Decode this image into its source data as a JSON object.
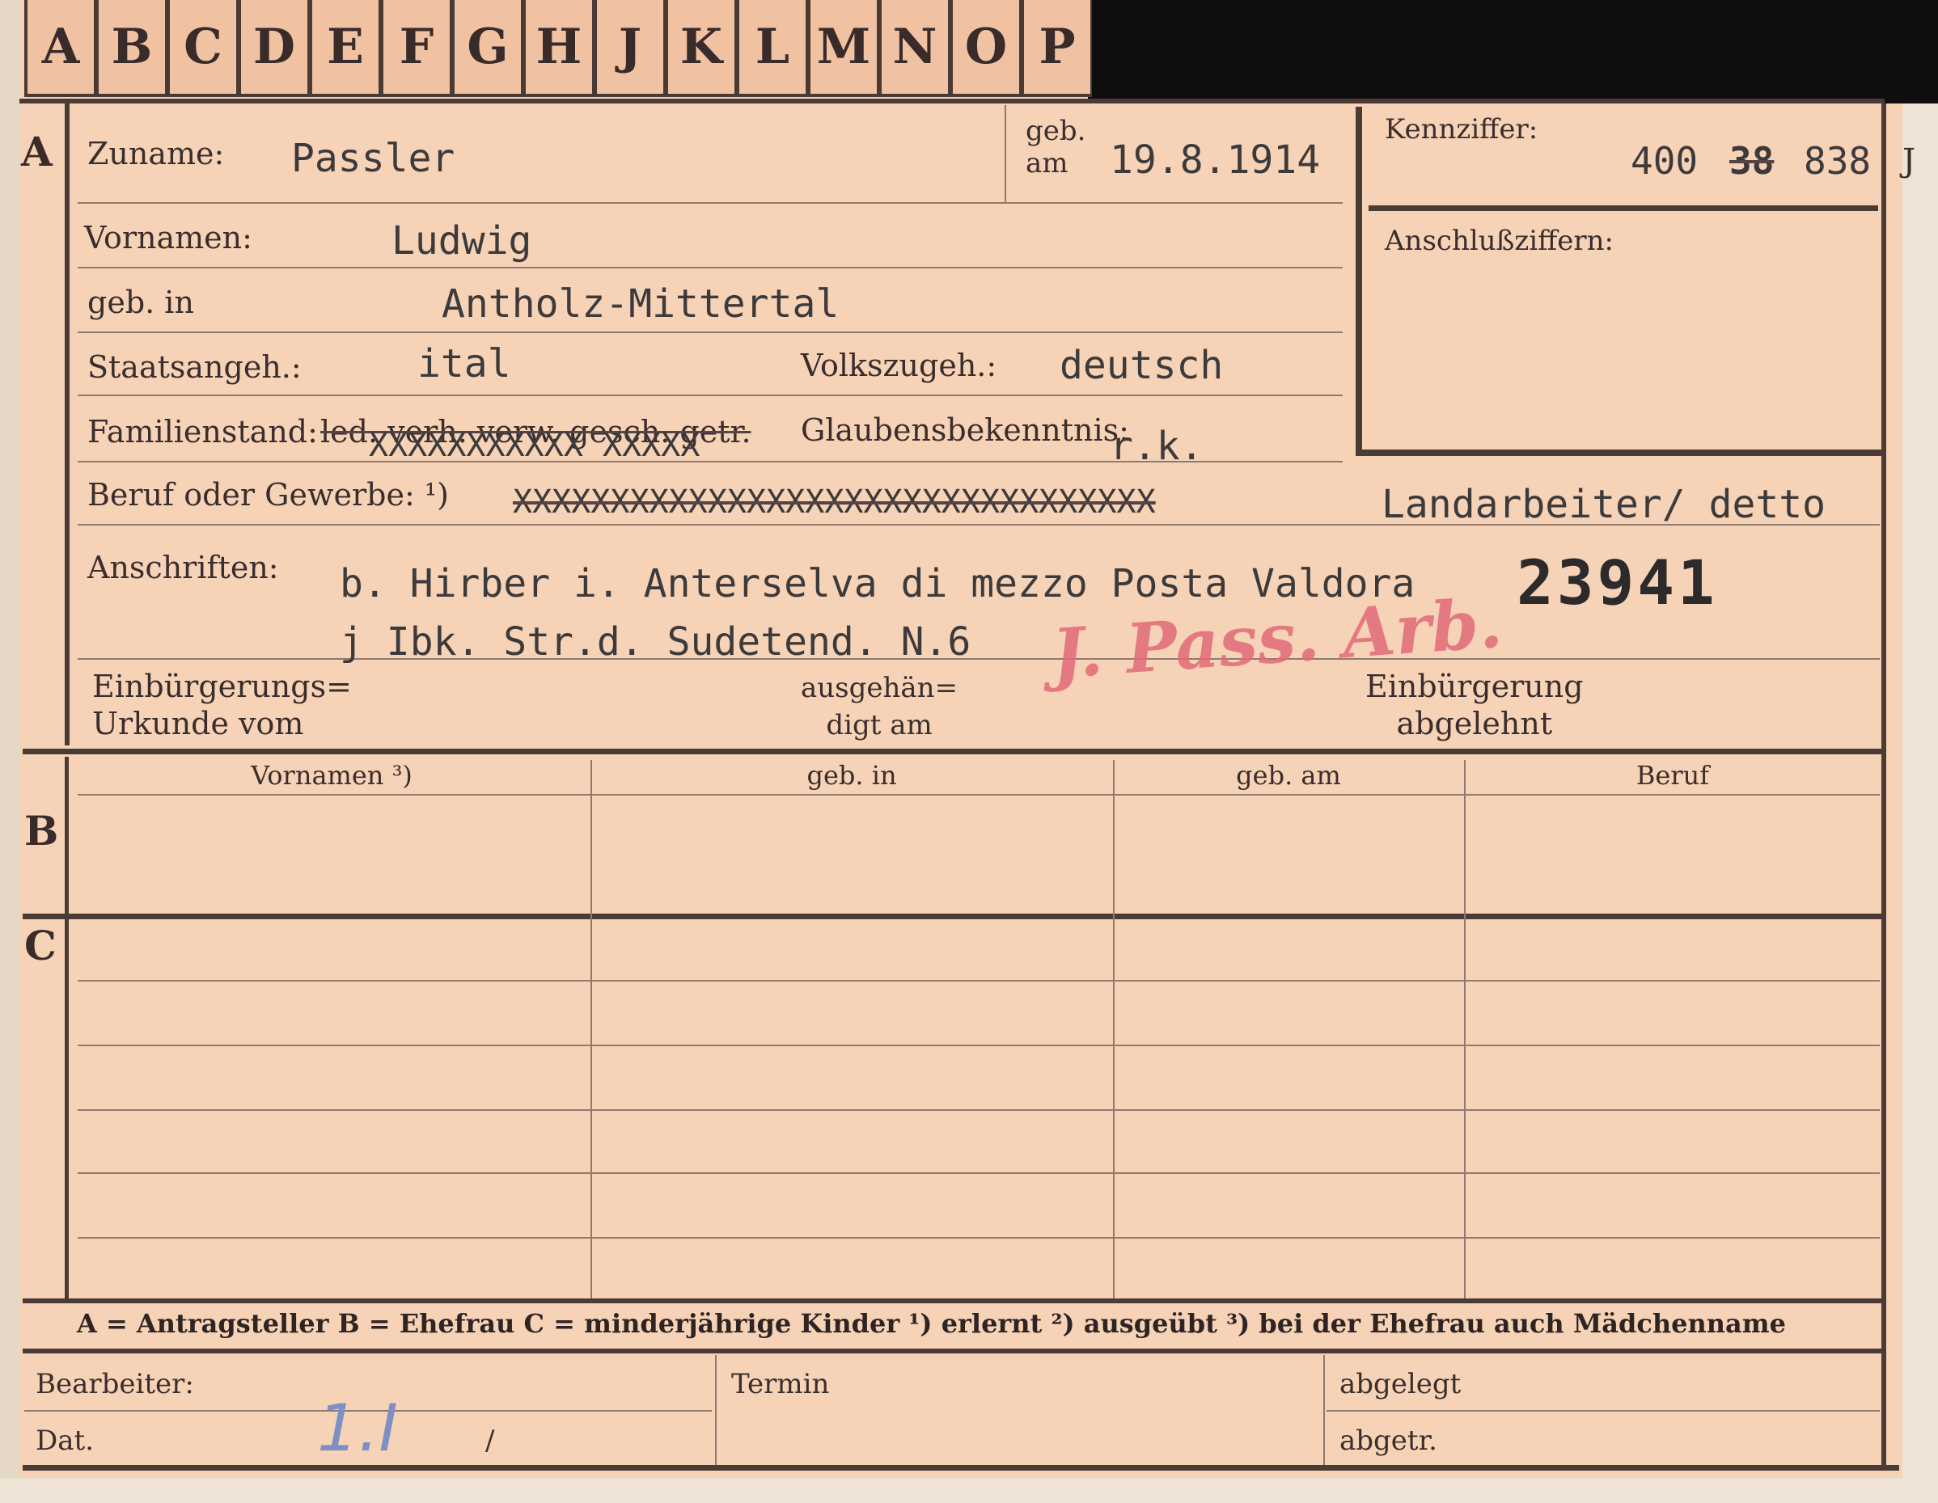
{
  "tabs": [
    "A",
    "B",
    "C",
    "D",
    "E",
    "F",
    "G",
    "H",
    "J",
    "K",
    "L",
    "M",
    "N",
    "O",
    "P"
  ],
  "sections": {
    "a": "A",
    "b": "B",
    "c": "C"
  },
  "labels": {
    "zuname": "Zuname:",
    "geb_am": "geb.\nam",
    "kennziffer": "Kennziffer:",
    "anschlussziffern": "Anschlußziffern:",
    "vornamen": "Vornamen:",
    "geb_in": "geb. in",
    "staatsangeh": "Staatsangeh.:",
    "volkszugeh": "Volkszugeh.:",
    "familienstand": "Familienstand:",
    "familienstand_opts": "led. verh. verw. gesch. getr.",
    "glaubensbekenntnis": "Glaubensbekenntnis:",
    "beruf": "Beruf oder Gewerbe: ¹)",
    "anschriften": "Anschriften:",
    "einbuergerungs_urkunde": "Einbürgerungs=\nUrkunde vom",
    "ausgehaendigt": "ausgehän=\ndigt am",
    "einbuergerung_abgelehnt": "Einbürgerung\nabgelehnt"
  },
  "values": {
    "zuname": "Passler",
    "geb_am": "19.8.1914",
    "kennziffer_a": "400",
    "kennziffer_b": "38",
    "kennziffer_c": "838",
    "kennziffer_side": "J",
    "vornamen": "Ludwig",
    "geb_in": "Antholz-Mittertal",
    "staatsangeh": "ital",
    "volkszugeh": "deutsch",
    "familienstand_x": "XXXXXXXXXXX XXXXX",
    "glaubensbekenntnis": "r.k.",
    "beruf_struck": "XXXXXXXXXXXXXXXXXXXXXXXXXXXXXXXXX",
    "beruf": "Landarbeiter/ detto",
    "anschrift_1": "b. Hirber i. Anterselva di mezzo Posta Valdora",
    "anschrift_2": "j Ibk. Str.d. Sudetend. N.6",
    "stamp_number": "23941"
  },
  "table_headers": [
    "Vornamen ³)",
    "geb. in",
    "geb. am",
    "Beruf"
  ],
  "legend": "A = Antragsteller   B = Ehefrau   C = minderjährige Kinder   ¹) erlernt   ²) ausgeübt   ³) bei der Ehefrau auch Mädchenname",
  "footer": {
    "bearbeiter": "Bearbeiter:",
    "termin": "Termin",
    "abgelegt": "abgelegt",
    "dat": "Dat.",
    "abgetr": "abgetr.",
    "dat_mark": "1.I",
    "dat_slash": "/"
  }
}
